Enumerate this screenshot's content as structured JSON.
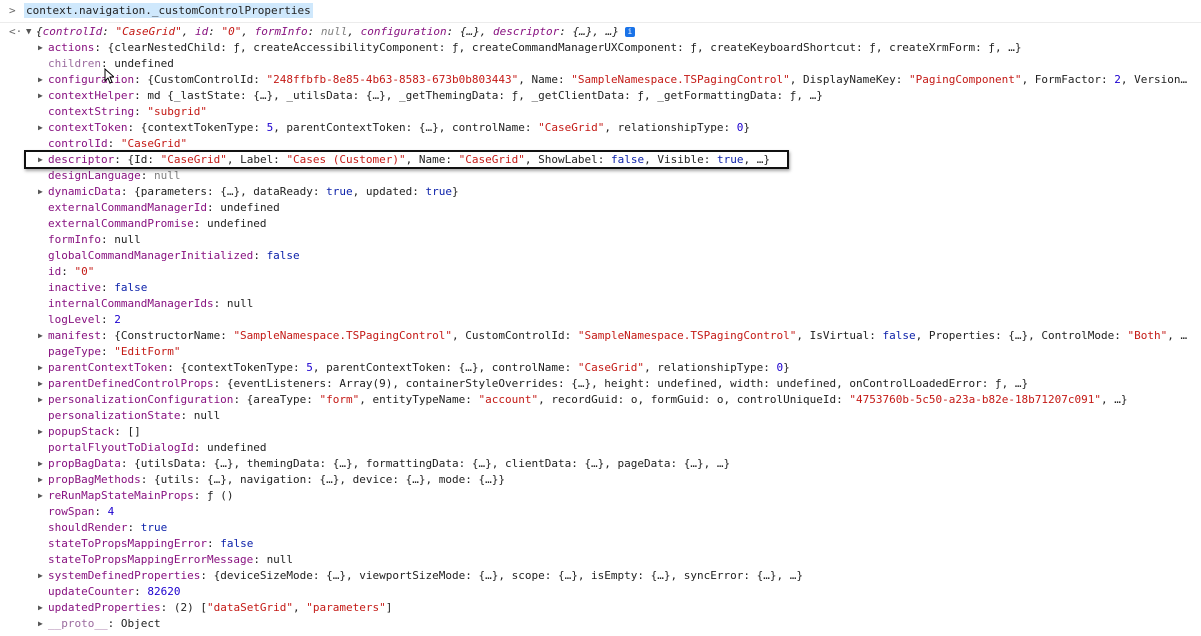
{
  "command": {
    "prompt_icon": "chevron-right-icon",
    "text": "context.navigation._customControlProperties"
  },
  "result": {
    "return_icon": "return-arrow-icon",
    "summary_parts": [
      {
        "t": "{",
        "c": "obj"
      },
      {
        "t": "controlId",
        "c": "key"
      },
      {
        "t": ": ",
        "c": "sep"
      },
      {
        "t": "\"CaseGrid\"",
        "c": "str"
      },
      {
        "t": ", ",
        "c": "sep"
      },
      {
        "t": "id",
        "c": "key"
      },
      {
        "t": ": ",
        "c": "sep"
      },
      {
        "t": "\"0\"",
        "c": "str"
      },
      {
        "t": ", ",
        "c": "sep"
      },
      {
        "t": "formInfo",
        "c": "key"
      },
      {
        "t": ": ",
        "c": "sep"
      },
      {
        "t": "null",
        "c": "nul"
      },
      {
        "t": ", ",
        "c": "sep"
      },
      {
        "t": "configuration",
        "c": "key"
      },
      {
        "t": ": {…}, ",
        "c": "sep"
      },
      {
        "t": "descriptor",
        "c": "key"
      },
      {
        "t": ": {…}, …}",
        "c": "sep"
      }
    ],
    "info_badge": "i"
  },
  "properties": [
    {
      "exp": true,
      "parts": [
        {
          "t": "actions",
          "c": "key"
        },
        {
          "t": ": {clearNestedChild: ƒ, createAccessibilityComponent: ƒ, createCommandManagerUXComponent: ƒ, createKeyboardShortcut: ƒ, createXrmForm: ƒ, …}",
          "c": "obj"
        }
      ]
    },
    {
      "exp": false,
      "parts": [
        {
          "t": "children",
          "c": "k-dim"
        },
        {
          "t": ": ",
          "c": "sep"
        },
        {
          "t": "undefined",
          "c": "obj"
        }
      ]
    },
    {
      "exp": true,
      "parts": [
        {
          "t": "configuration",
          "c": "key"
        },
        {
          "t": ": {CustomControlId: ",
          "c": "obj"
        },
        {
          "t": "\"248ffbfb-8e85-4b63-8583-673b0b803443\"",
          "c": "str"
        },
        {
          "t": ", Name: ",
          "c": "obj"
        },
        {
          "t": "\"SampleNamespace.TSPagingControl\"",
          "c": "str"
        },
        {
          "t": ", DisplayNameKey: ",
          "c": "obj"
        },
        {
          "t": "\"PagingComponent\"",
          "c": "str"
        },
        {
          "t": ", FormFactor: ",
          "c": "obj"
        },
        {
          "t": "2",
          "c": "num"
        },
        {
          "t": ", Version…",
          "c": "obj"
        }
      ]
    },
    {
      "exp": true,
      "parts": [
        {
          "t": "contextHelper",
          "c": "key"
        },
        {
          "t": ": md {_lastState: {…}, _utilsData: {…}, _getThemingData: ƒ, _getClientData: ƒ, _getFormattingData: ƒ, …}",
          "c": "obj"
        }
      ]
    },
    {
      "exp": false,
      "parts": [
        {
          "t": "contextString",
          "c": "key"
        },
        {
          "t": ": ",
          "c": "sep"
        },
        {
          "t": "\"subgrid\"",
          "c": "str"
        }
      ]
    },
    {
      "exp": true,
      "parts": [
        {
          "t": "contextToken",
          "c": "key"
        },
        {
          "t": ": {contextTokenType: ",
          "c": "obj"
        },
        {
          "t": "5",
          "c": "num"
        },
        {
          "t": ", parentContextToken: {…}, controlName: ",
          "c": "obj"
        },
        {
          "t": "\"CaseGrid\"",
          "c": "str"
        },
        {
          "t": ", relationshipType: ",
          "c": "obj"
        },
        {
          "t": "0",
          "c": "num"
        },
        {
          "t": "}",
          "c": "obj"
        }
      ]
    },
    {
      "exp": false,
      "parts": [
        {
          "t": "controlId",
          "c": "key"
        },
        {
          "t": ": ",
          "c": "sep"
        },
        {
          "t": "\"CaseGrid\"",
          "c": "str"
        }
      ]
    },
    {
      "exp": true,
      "parts": [
        {
          "t": "descriptor",
          "c": "key"
        },
        {
          "t": ": {Id: ",
          "c": "obj"
        },
        {
          "t": "\"CaseGrid\"",
          "c": "str"
        },
        {
          "t": ", Label: ",
          "c": "obj"
        },
        {
          "t": "\"Cases (Customer)\"",
          "c": "str"
        },
        {
          "t": ", Name: ",
          "c": "obj"
        },
        {
          "t": "\"CaseGrid\"",
          "c": "str"
        },
        {
          "t": ", ShowLabel: ",
          "c": "obj"
        },
        {
          "t": "false",
          "c": "kw"
        },
        {
          "t": ", Visible: ",
          "c": "obj"
        },
        {
          "t": "true",
          "c": "kw"
        },
        {
          "t": ", …}",
          "c": "obj"
        }
      ]
    },
    {
      "exp": false,
      "parts": [
        {
          "t": "designLanguage",
          "c": "key"
        },
        {
          "t": ": ",
          "c": "sep"
        },
        {
          "t": "null",
          "c": "nul"
        }
      ]
    },
    {
      "exp": true,
      "parts": [
        {
          "t": "dynamicData",
          "c": "key"
        },
        {
          "t": ": {parameters: {…}, dataReady: ",
          "c": "obj"
        },
        {
          "t": "true",
          "c": "kw"
        },
        {
          "t": ", updated: ",
          "c": "obj"
        },
        {
          "t": "true",
          "c": "kw"
        },
        {
          "t": "}",
          "c": "obj"
        }
      ]
    },
    {
      "exp": false,
      "parts": [
        {
          "t": "externalCommandManagerId",
          "c": "key"
        },
        {
          "t": ": ",
          "c": "sep"
        },
        {
          "t": "undefined",
          "c": "obj"
        }
      ]
    },
    {
      "exp": false,
      "parts": [
        {
          "t": "externalCommandPromise",
          "c": "key"
        },
        {
          "t": ": ",
          "c": "sep"
        },
        {
          "t": "undefined",
          "c": "obj"
        }
      ]
    },
    {
      "exp": false,
      "parts": [
        {
          "t": "formInfo",
          "c": "key"
        },
        {
          "t": ": ",
          "c": "sep"
        },
        {
          "t": "null",
          "c": "obj"
        }
      ]
    },
    {
      "exp": false,
      "parts": [
        {
          "t": "globalCommandManagerInitialized",
          "c": "key"
        },
        {
          "t": ": ",
          "c": "sep"
        },
        {
          "t": "false",
          "c": "kw"
        }
      ]
    },
    {
      "exp": false,
      "parts": [
        {
          "t": "id",
          "c": "key"
        },
        {
          "t": ": ",
          "c": "sep"
        },
        {
          "t": "\"0\"",
          "c": "str"
        }
      ]
    },
    {
      "exp": false,
      "parts": [
        {
          "t": "inactive",
          "c": "key"
        },
        {
          "t": ": ",
          "c": "sep"
        },
        {
          "t": "false",
          "c": "kw"
        }
      ]
    },
    {
      "exp": false,
      "parts": [
        {
          "t": "internalCommandManagerIds",
          "c": "key"
        },
        {
          "t": ": ",
          "c": "sep"
        },
        {
          "t": "null",
          "c": "obj"
        }
      ]
    },
    {
      "exp": false,
      "parts": [
        {
          "t": "logLevel",
          "c": "key"
        },
        {
          "t": ": ",
          "c": "sep"
        },
        {
          "t": "2",
          "c": "num"
        }
      ]
    },
    {
      "exp": true,
      "parts": [
        {
          "t": "manifest",
          "c": "key"
        },
        {
          "t": ": {ConstructorName: ",
          "c": "obj"
        },
        {
          "t": "\"SampleNamespace.TSPagingControl\"",
          "c": "str"
        },
        {
          "t": ", CustomControlId: ",
          "c": "obj"
        },
        {
          "t": "\"SampleNamespace.TSPagingControl\"",
          "c": "str"
        },
        {
          "t": ", IsVirtual: ",
          "c": "obj"
        },
        {
          "t": "false",
          "c": "kw"
        },
        {
          "t": ", Properties: {…}, ControlMode: ",
          "c": "obj"
        },
        {
          "t": "\"Both\"",
          "c": "str"
        },
        {
          "t": ", …",
          "c": "obj"
        }
      ]
    },
    {
      "exp": false,
      "parts": [
        {
          "t": "pageType",
          "c": "key"
        },
        {
          "t": ": ",
          "c": "sep"
        },
        {
          "t": "\"EditForm\"",
          "c": "str"
        }
      ]
    },
    {
      "exp": true,
      "parts": [
        {
          "t": "parentContextToken",
          "c": "key"
        },
        {
          "t": ": {contextTokenType: ",
          "c": "obj"
        },
        {
          "t": "5",
          "c": "num"
        },
        {
          "t": ", parentContextToken: {…}, controlName: ",
          "c": "obj"
        },
        {
          "t": "\"CaseGrid\"",
          "c": "str"
        },
        {
          "t": ", relationshipType: ",
          "c": "obj"
        },
        {
          "t": "0",
          "c": "num"
        },
        {
          "t": "}",
          "c": "obj"
        }
      ]
    },
    {
      "exp": true,
      "parts": [
        {
          "t": "parentDefinedControlProps",
          "c": "key"
        },
        {
          "t": ": {eventListeners: Array(9), containerStyleOverrides: {…}, height: undefined, width: undefined, onControlLoadedError: ƒ, …}",
          "c": "obj"
        }
      ]
    },
    {
      "exp": true,
      "parts": [
        {
          "t": "personalizationConfiguration",
          "c": "key"
        },
        {
          "t": ": {areaType: ",
          "c": "obj"
        },
        {
          "t": "\"form\"",
          "c": "str"
        },
        {
          "t": ", entityTypeName: ",
          "c": "obj"
        },
        {
          "t": "\"account\"",
          "c": "str"
        },
        {
          "t": ", recordGuid: o, formGuid: o, controlUniqueId: ",
          "c": "obj"
        },
        {
          "t": "\"4753760b-5c50-a23a-b82e-18b71207c091\"",
          "c": "str"
        },
        {
          "t": ", …}",
          "c": "obj"
        }
      ]
    },
    {
      "exp": false,
      "parts": [
        {
          "t": "personalizationState",
          "c": "key"
        },
        {
          "t": ": ",
          "c": "sep"
        },
        {
          "t": "null",
          "c": "obj"
        }
      ]
    },
    {
      "exp": true,
      "parts": [
        {
          "t": "popupStack",
          "c": "key"
        },
        {
          "t": ": []",
          "c": "obj"
        }
      ]
    },
    {
      "exp": false,
      "parts": [
        {
          "t": "portalFlyoutToDialogId",
          "c": "key"
        },
        {
          "t": ": ",
          "c": "sep"
        },
        {
          "t": "undefined",
          "c": "obj"
        }
      ]
    },
    {
      "exp": true,
      "parts": [
        {
          "t": "propBagData",
          "c": "key"
        },
        {
          "t": ": {utilsData: {…}, themingData: {…}, formattingData: {…}, clientData: {…}, pageData: {…}, …}",
          "c": "obj"
        }
      ]
    },
    {
      "exp": true,
      "parts": [
        {
          "t": "propBagMethods",
          "c": "key"
        },
        {
          "t": ": {utils: {…}, navigation: {…}, device: {…}, mode: {…}}",
          "c": "obj"
        }
      ]
    },
    {
      "exp": true,
      "parts": [
        {
          "t": "reRunMapStateMainProps",
          "c": "key"
        },
        {
          "t": ": ƒ ()",
          "c": "obj"
        }
      ]
    },
    {
      "exp": false,
      "parts": [
        {
          "t": "rowSpan",
          "c": "key"
        },
        {
          "t": ": ",
          "c": "sep"
        },
        {
          "t": "4",
          "c": "num"
        }
      ]
    },
    {
      "exp": false,
      "parts": [
        {
          "t": "shouldRender",
          "c": "key"
        },
        {
          "t": ": ",
          "c": "sep"
        },
        {
          "t": "true",
          "c": "kw"
        }
      ]
    },
    {
      "exp": false,
      "parts": [
        {
          "t": "stateToPropsMappingError",
          "c": "key"
        },
        {
          "t": ": ",
          "c": "sep"
        },
        {
          "t": "false",
          "c": "kw"
        }
      ]
    },
    {
      "exp": false,
      "parts": [
        {
          "t": "stateToPropsMappingErrorMessage",
          "c": "key"
        },
        {
          "t": ": ",
          "c": "sep"
        },
        {
          "t": "null",
          "c": "obj"
        }
      ]
    },
    {
      "exp": true,
      "parts": [
        {
          "t": "systemDefinedProperties",
          "c": "key"
        },
        {
          "t": ": {deviceSizeMode: {…}, viewportSizeMode: {…}, scope: {…}, isEmpty: {…}, syncError: {…}, …}",
          "c": "obj"
        }
      ]
    },
    {
      "exp": false,
      "parts": [
        {
          "t": "updateCounter",
          "c": "key"
        },
        {
          "t": ": ",
          "c": "sep"
        },
        {
          "t": "82620",
          "c": "num"
        }
      ]
    },
    {
      "exp": true,
      "parts": [
        {
          "t": "updatedProperties",
          "c": "key"
        },
        {
          "t": ": (2) [",
          "c": "obj"
        },
        {
          "t": "\"dataSetGrid\"",
          "c": "str"
        },
        {
          "t": ", ",
          "c": "obj"
        },
        {
          "t": "\"parameters\"",
          "c": "str"
        },
        {
          "t": "]",
          "c": "obj"
        }
      ]
    },
    {
      "exp": true,
      "parts": [
        {
          "t": "__proto__",
          "c": "k-dim"
        },
        {
          "t": ": Object",
          "c": "obj"
        }
      ]
    }
  ],
  "colors": {
    "command_highlight": "#cfe8fc",
    "key": "#881280",
    "string": "#c41a16",
    "number": "#1c00cf",
    "keyword": "#0d22aa",
    "null": "#808080"
  }
}
